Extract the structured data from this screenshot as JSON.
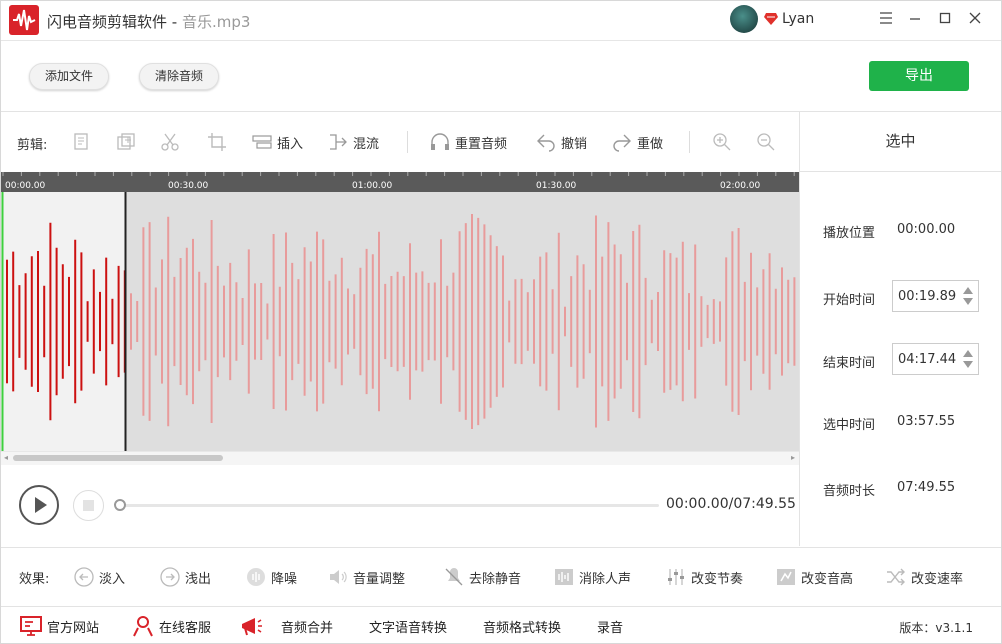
{
  "app": {
    "title": "闪电音频剪辑软件 - ",
    "file": "音乐.mp3",
    "user": "Lyan"
  },
  "actions": {
    "add_file": "添加文件",
    "clear_audio": "清除音频",
    "export": "导出"
  },
  "toolbar": {
    "label": "剪辑:",
    "insert": "插入",
    "mix": "混流",
    "reset": "重置音频",
    "undo": "撤销",
    "redo": "重做"
  },
  "timeline": {
    "ticks": [
      "00:00.00",
      "00:30.00",
      "01:00.00",
      "01:30.00",
      "02:00.00"
    ]
  },
  "panel": {
    "title": "选中",
    "play_pos_label": "播放位置",
    "play_pos": "00:00.00",
    "start_label": "开始时间",
    "start": "00:19.89",
    "end_label": "结束时间",
    "end": "04:17.44",
    "selected_label": "选中时间",
    "selected": "03:57.55",
    "duration_label": "音频时长",
    "duration": "07:49.55"
  },
  "player": {
    "time": "00:00.00/07:49.55",
    "progress": 0
  },
  "effects": {
    "label": "效果:",
    "items": [
      "淡入",
      "浅出",
      "降噪",
      "音量调整",
      "去除静音",
      "消除人声",
      "改变节奏",
      "改变音高",
      "改变速率"
    ]
  },
  "footer": {
    "website": "官方网站",
    "support": "在线客服",
    "merge": "音频合并",
    "tts": "文字语音转换",
    "convert": "音频格式转换",
    "record": "录音",
    "version": "版本：v3.1.1"
  },
  "colors": {
    "accent_red": "#d9232a",
    "wave_selected": "#cc1111",
    "wave_unselected": "#e89b9b",
    "export_green": "#1fb24a"
  }
}
